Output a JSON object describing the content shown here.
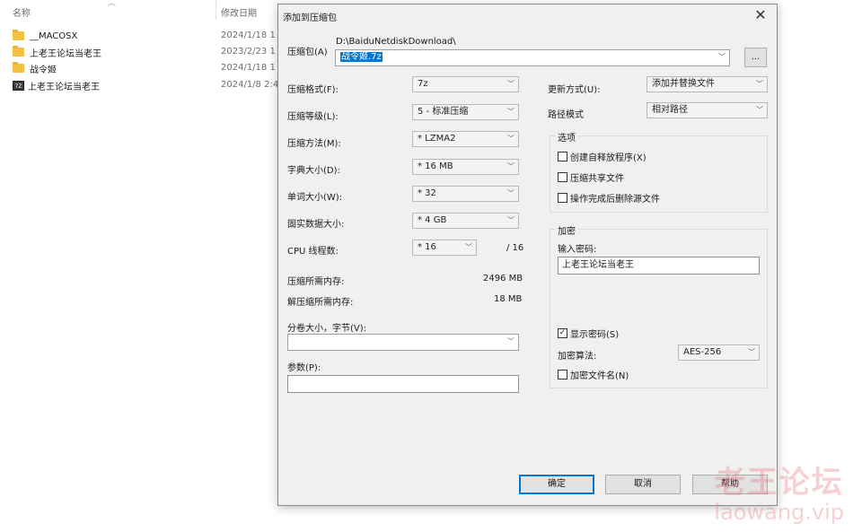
{
  "explorer": {
    "col_name": "名称",
    "col_date": "修改日期",
    "files": [
      {
        "name": "__MACOSX",
        "date": "2024/1/18 1",
        "type": "folder"
      },
      {
        "name": "上老王论坛当老王",
        "date": "2023/2/23 1",
        "type": "folder"
      },
      {
        "name": "战令姬",
        "date": "2024/1/18 1",
        "type": "folder"
      },
      {
        "name": "上老王论坛当老王",
        "date": "2024/1/8 2:4",
        "type": "archive",
        "icon_text": "7Z"
      }
    ]
  },
  "dialog": {
    "title": "添加到压缩包",
    "archive_label": "压缩包(A)",
    "archive_path": "D:\\BaiduNetdiskDownload\\",
    "archive_name": "战令姬.7z",
    "browse_label": "...",
    "format_label": "压缩格式(F):",
    "format_value": "7z",
    "level_label": "压缩等级(L):",
    "level_value": "5 - 标准压缩",
    "method_label": "压缩方法(M):",
    "method_value": "* LZMA2",
    "dict_label": "字典大小(D):",
    "dict_value": "* 16 MB",
    "word_label": "单词大小(W):",
    "word_value": "* 32",
    "solid_label": "固实数据大小:",
    "solid_value": "* 4 GB",
    "cpu_label": "CPU 线程数:",
    "cpu_value": "* 16",
    "cpu_total": "/ 16",
    "mem_comp_label": "压缩所需内存:",
    "mem_comp_value": "2496 MB",
    "mem_decomp_label": "解压缩所需内存:",
    "mem_decomp_value": "18 MB",
    "split_label": "分卷大小，字节(V):",
    "split_value": "",
    "params_label": "参数(P):",
    "params_value": "",
    "update_label": "更新方式(U):",
    "update_value": "添加并替换文件",
    "pathmode_label": "路径模式",
    "pathmode_value": "相对路径",
    "options_title": "选项",
    "opt_sfx": "创建自释放程序(X)",
    "opt_shared": "压缩共享文件",
    "opt_delete": "操作完成后删除源文件",
    "encrypt_title": "加密",
    "password_label": "输入密码:",
    "password_value": "上老王论坛当老王",
    "show_password": "显示密码(S)",
    "encrypt_method_label": "加密算法:",
    "encrypt_method_value": "AES-256",
    "encrypt_names": "加密文件名(N)",
    "ok_label": "确定",
    "cancel_label": "取消",
    "help_label": "帮助"
  },
  "watermark": {
    "line1": "老王论坛",
    "line2": "laowang.vip"
  }
}
